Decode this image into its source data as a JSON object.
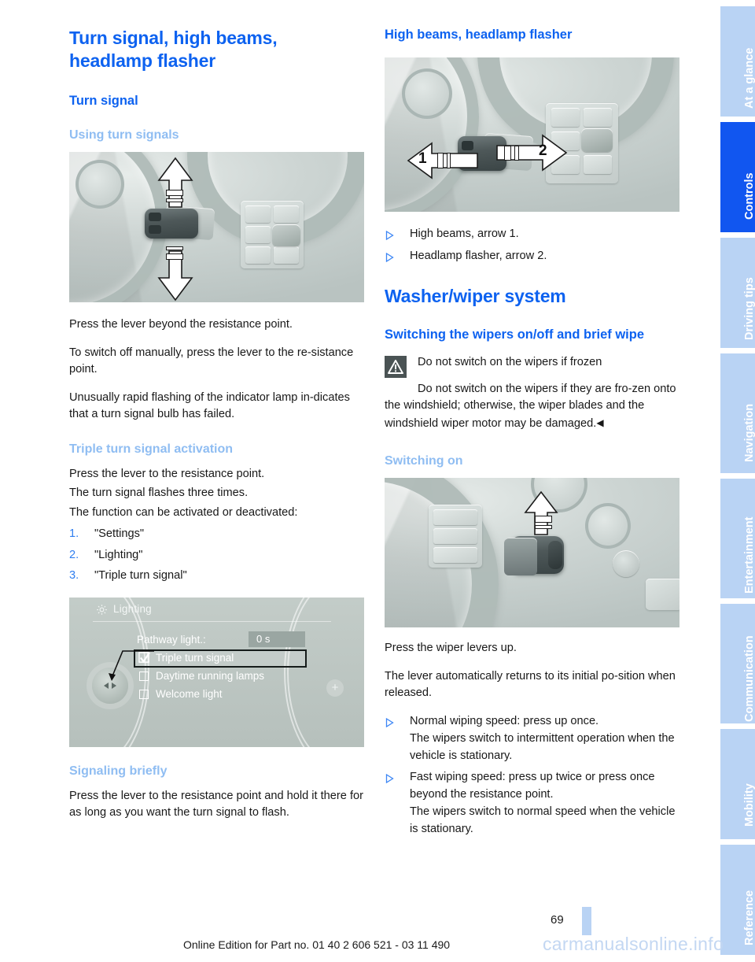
{
  "page": {
    "number": "69",
    "footer_note": "Online Edition for Part no. 01 40 2 606 521 - 03 11 490",
    "watermark": "carmanualsonline.info"
  },
  "colors": {
    "heading_blue": "#0d62f0",
    "subheading_blue": "#8fbdf2",
    "accent_tab_active": "#1156f0",
    "accent_tab_inactive": "#b9d3f4",
    "body_text": "#181818",
    "warning_icon_bg": "#4a5354"
  },
  "left_column": {
    "chapter_title": "Turn signal, high beams, headlamp flasher",
    "section_title": "Turn signal",
    "sub1_title": "Using turn signals",
    "figure1_alt": "Steering column turn signal lever with up and down arrows",
    "sub1_paragraphs": [
      "Press the lever beyond the resistance point.",
      "To switch off manually, press the lever to the re-sistance point.",
      "Unusually rapid flashing of the indicator lamp in-dicates that a turn signal bulb has failed."
    ],
    "sub2_title": "Triple turn signal activation",
    "sub2_paragraphs": [
      "Press the lever to the resistance point.",
      "The turn signal flashes three times.",
      "The function can be activated or deactivated:"
    ],
    "steps": [
      {
        "num": "1.",
        "label": "\"Settings\""
      },
      {
        "num": "2.",
        "label": "\"Lighting\""
      },
      {
        "num": "3.",
        "label": "\"Triple turn signal\""
      }
    ],
    "idrive": {
      "menu_title": "Lighting",
      "rows": [
        {
          "label": "Pathway light.:",
          "value": "0 s",
          "type": "value"
        },
        {
          "label": "Triple turn signal",
          "checked": true,
          "selected": true,
          "type": "check"
        },
        {
          "label": "Daytime running lamps",
          "checked": false,
          "selected": false,
          "type": "check"
        },
        {
          "label": "Welcome light",
          "checked": false,
          "selected": false,
          "type": "check"
        }
      ],
      "plus_label": "+"
    },
    "sub3_title": "Signaling briefly",
    "sub3_paragraph": "Press the lever to the resistance point and hold it there for as long as you want the turn signal to flash."
  },
  "right_column": {
    "sub1_title": "High beams, headlamp flasher",
    "figure2_alt": "Turn signal lever with arrows 1 and 2",
    "figure2_labels": {
      "left": "1",
      "right": "2"
    },
    "bullets1": [
      "High beams, arrow 1.",
      "Headlamp flasher, arrow 2."
    ],
    "section_title": "Washer/wiper system",
    "sub2_title": "Switching the wipers on/off and brief wipe",
    "warning": {
      "icon": "warning-triangle-icon",
      "headline": "Do not switch on the wipers if frozen",
      "text": "Do not switch on the wipers if they are fro-zen onto the windshield; otherwise, the wiper blades and the windshield wiper motor may be damaged.",
      "end_marker": "◀"
    },
    "sub3_title": "Switching on",
    "figure3_alt": "Wiper lever with up arrow",
    "sub3_paragraphs": [
      "Press the wiper levers up.",
      "The lever automatically returns to its initial po-sition when released."
    ],
    "bullets2": [
      {
        "lead": "Normal wiping speed: press up once.",
        "cont": "The wipers switch to intermittent operation when the vehicle is stationary."
      },
      {
        "lead": "Fast wiping speed: press up twice or press once beyond the resistance point.",
        "cont": "The wipers switch to normal speed when the vehicle is stationary."
      }
    ]
  },
  "sidebar": {
    "tabs": [
      {
        "label": "At a glance",
        "active": false
      },
      {
        "label": "Controls",
        "active": true
      },
      {
        "label": "Driving tips",
        "active": false
      },
      {
        "label": "Navigation",
        "active": false
      },
      {
        "label": "Entertainment",
        "active": false
      },
      {
        "label": "Communication",
        "active": false
      },
      {
        "label": "Mobility",
        "active": false
      },
      {
        "label": "Reference",
        "active": false
      }
    ]
  }
}
